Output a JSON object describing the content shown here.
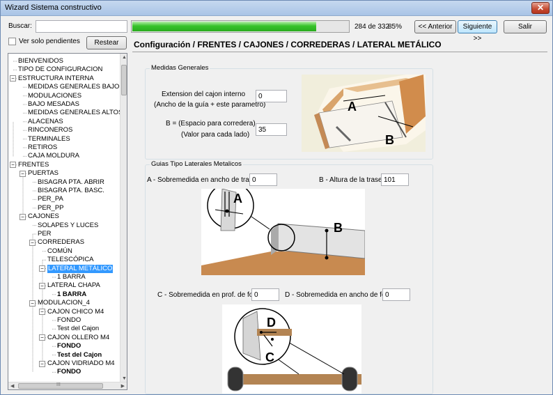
{
  "window": {
    "title": "Wizard Sistema constructivo"
  },
  "toolbar": {
    "search_label": "Buscar:",
    "search_value": "",
    "progress_fraction": 0.85,
    "progress_text": "284 de 332",
    "progress_percent": "85%",
    "prev_label": "<< Anterior",
    "next_label": "Siguiente >>",
    "exit_label": "Salir",
    "pending_label": "Ver solo pendientes",
    "reset_label": "Restear"
  },
  "page": {
    "heading": "Configuración / FRENTES / CAJONES / CORREDERAS / LATERAL METÁLICO"
  },
  "tree": {
    "items": [
      {
        "label": "BIENVENIDOS"
      },
      {
        "label": "TIPO DE CONFIGURACION"
      },
      {
        "label": "ESTRUCTURA INTERNA"
      },
      {
        "label": "MEDIDAS GENERALES BAJOS"
      },
      {
        "label": "MODULACIONES"
      },
      {
        "label": "BAJO MESADAS"
      },
      {
        "label": "MEDIDAS GENERALES ALTOS"
      },
      {
        "label": "ALACENAS"
      },
      {
        "label": "RINCONEROS"
      },
      {
        "label": "TERMINALES"
      },
      {
        "label": "RETIROS"
      },
      {
        "label": "CAJA MOLDURA"
      },
      {
        "label": "FRENTES"
      },
      {
        "label": "PUERTAS"
      },
      {
        "label": "BISAGRA PTA. ABRIR"
      },
      {
        "label": "BISAGRA PTA. BASC."
      },
      {
        "label": "PER_PA"
      },
      {
        "label": "PER_PP"
      },
      {
        "label": "CAJONES"
      },
      {
        "label": "SOLAPES Y LUCES"
      },
      {
        "label": "PER"
      },
      {
        "label": "CORREDERAS"
      },
      {
        "label": "COMÚN"
      },
      {
        "label": "TELESCÓPICA"
      },
      {
        "label": "LATERAL METÁLICO"
      },
      {
        "label": "1 BARRA"
      },
      {
        "label": "LATERAL CHAPA"
      },
      {
        "label": "1 BARRA"
      },
      {
        "label": "MODULACION_4"
      },
      {
        "label": "CAJON CHICO M4"
      },
      {
        "label": "FONDO"
      },
      {
        "label": "Test del Cajon"
      },
      {
        "label": "CAJON OLLERO M4"
      },
      {
        "label": "FONDO"
      },
      {
        "label": "Test del Cajon"
      },
      {
        "label": "CAJON VIDRIADO M4"
      },
      {
        "label": "FONDO"
      }
    ]
  },
  "medidas": {
    "group_title": "Medidas Generales",
    "ext_label_1": "Extension del cajon interno",
    "ext_label_2": "(Ancho de la guía + este parametro)",
    "ext_value": "0",
    "b_label_1": "B = (Espacio para corredera)",
    "b_label_2": "(Valor para cada lado)",
    "b_value": "35",
    "pic_label_a": "A",
    "pic_label_b": "B"
  },
  "guias": {
    "group_title": "Guias Tipo Laterales Metalicos",
    "a_label": "A - Sobremedida en ancho de trasera:",
    "a_value": "0",
    "b_label": "B - Altura de la trasera:",
    "b_value": "101",
    "c_label": "C - Sobremedida en prof. de fondo:",
    "c_value": "0",
    "d_label": "D - Sobremedida en ancho de fondo:",
    "d_value": "0",
    "pic1_label_a": "A",
    "pic1_label_b": "B",
    "pic2_label_d": "D",
    "pic2_label_c": "C"
  },
  "scroll": {
    "hgrip": "III"
  }
}
